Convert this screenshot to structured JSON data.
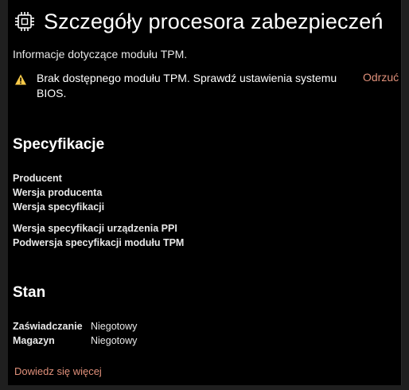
{
  "header": {
    "title": "Szczegóły procesora zabezpieczeń",
    "subtitle": "Informacje dotyczące modułu TPM.",
    "icon": "processor-chip-icon"
  },
  "warning": {
    "icon": "warning-icon",
    "text": "Brak dostępnego modułu TPM. Sprawdź ustawienia systemu BIOS.",
    "dismiss_label": "Odrzuć",
    "color": "#f7c948"
  },
  "specs": {
    "title": "Specyfikacje",
    "group1": [
      "Producent",
      "Wersja producenta",
      "Wersja specyfikacji"
    ],
    "group2": [
      "Wersja specyfikacji urządzenia PPI",
      "Podwersja specyfikacji modułu TPM"
    ]
  },
  "status": {
    "title": "Stan",
    "rows": [
      {
        "label": "Zaświadczanie",
        "value": "Niegotowy"
      },
      {
        "label": "Magazyn",
        "value": "Niegotowy"
      }
    ]
  },
  "footer": {
    "learn_more": "Dowiedz się więcej",
    "link_color": "#e0907a"
  }
}
